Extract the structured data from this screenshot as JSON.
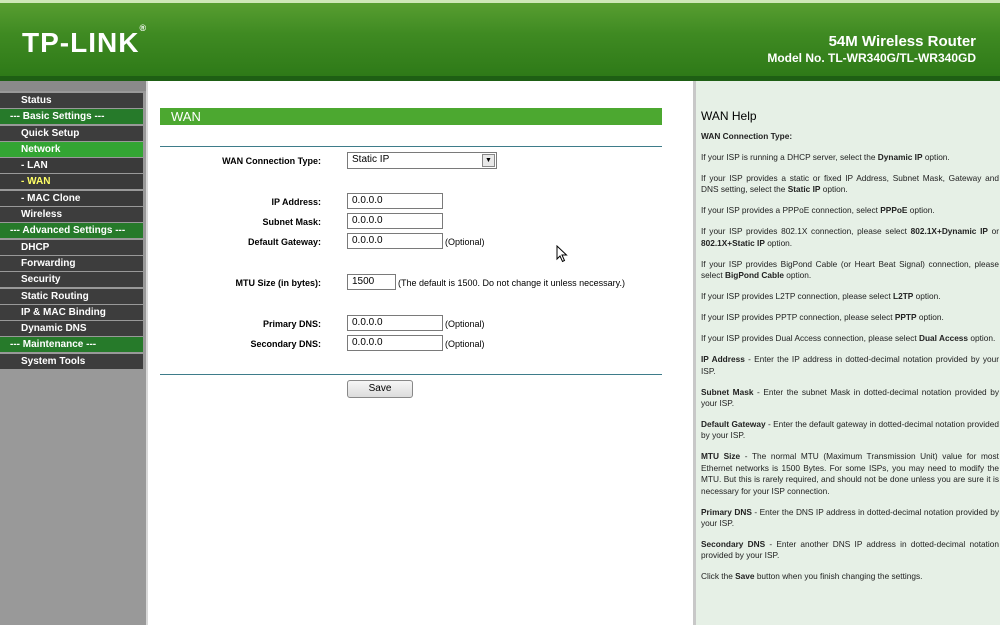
{
  "header": {
    "logo": "TP-LINK",
    "logo_mark": "®",
    "product": "54M Wireless Router",
    "model": "Model No. TL-WR340G/TL-WR340GD"
  },
  "sidebar": {
    "items": [
      {
        "label": "Status",
        "type": "top"
      },
      {
        "label": "--- Basic Settings ---",
        "type": "sec"
      },
      {
        "label": "Quick Setup",
        "type": "top"
      },
      {
        "label": "Network",
        "type": "top active"
      },
      {
        "label": "- LAN",
        "type": "sub"
      },
      {
        "label": "- WAN",
        "type": "sub current"
      },
      {
        "label": "- MAC Clone",
        "type": "sub"
      },
      {
        "label": "Wireless",
        "type": "top"
      },
      {
        "label": "--- Advanced Settings ---",
        "type": "sec"
      },
      {
        "label": "DHCP",
        "type": "top"
      },
      {
        "label": "Forwarding",
        "type": "top"
      },
      {
        "label": "Security",
        "type": "top"
      },
      {
        "label": "Static Routing",
        "type": "top"
      },
      {
        "label": "IP & MAC Binding",
        "type": "top"
      },
      {
        "label": "Dynamic DNS",
        "type": "top"
      },
      {
        "label": "--- Maintenance ---",
        "type": "sec"
      },
      {
        "label": "System Tools",
        "type": "top"
      }
    ]
  },
  "main": {
    "section_title": "WAN",
    "wan_connection_type": {
      "label": "WAN Connection Type:",
      "value": "Static IP"
    },
    "ip_address": {
      "label": "IP Address:",
      "value": "0.0.0.0"
    },
    "subnet_mask": {
      "label": "Subnet Mask:",
      "value": "0.0.0.0"
    },
    "default_gateway": {
      "label": "Default Gateway:",
      "value": "0.0.0.0",
      "note": "(Optional)"
    },
    "mtu_size": {
      "label": "MTU Size (in bytes):",
      "value": "1500",
      "note": "(The default is 1500. Do not change it unless necessary.)"
    },
    "primary_dns": {
      "label": "Primary DNS:",
      "value": "0.0.0.0",
      "note": "(Optional)"
    },
    "secondary_dns": {
      "label": "Secondary DNS:",
      "value": "0.0.0.0",
      "note": "(Optional)"
    },
    "save_label": "Save"
  },
  "help": {
    "title": "WAN Help",
    "paragraphs": [
      {
        "parts": [
          {
            "b": "WAN Connection Type:"
          }
        ]
      },
      {
        "parts": [
          {
            "t": "If your ISP is running a DHCP server, select the "
          },
          {
            "b": "Dynamic IP"
          },
          {
            "t": " option."
          }
        ]
      },
      {
        "parts": [
          {
            "t": "If your ISP provides a static or fixed IP Address, Subnet Mask, Gateway and DNS setting, select the "
          },
          {
            "b": "Static IP"
          },
          {
            "t": " option."
          }
        ]
      },
      {
        "parts": [
          {
            "t": "If your ISP provides a PPPoE connection, select "
          },
          {
            "b": "PPPoE"
          },
          {
            "t": " option."
          }
        ]
      },
      {
        "parts": [
          {
            "t": "If your ISP provides 802.1X connection, please select "
          },
          {
            "b": "802.1X+Dynamic IP"
          },
          {
            "t": " or "
          },
          {
            "b": "802.1X+Static IP"
          },
          {
            "t": " option."
          }
        ]
      },
      {
        "parts": [
          {
            "t": "If your ISP provides BigPond Cable (or Heart Beat Signal) connection, please select "
          },
          {
            "b": "BigPond Cable"
          },
          {
            "t": " option."
          }
        ]
      },
      {
        "parts": [
          {
            "t": "If your ISP provides L2TP connection, please select "
          },
          {
            "b": "L2TP"
          },
          {
            "t": " option."
          }
        ]
      },
      {
        "parts": [
          {
            "t": "If your ISP provides PPTP connection, please select "
          },
          {
            "b": "PPTP"
          },
          {
            "t": " option."
          }
        ]
      },
      {
        "parts": [
          {
            "t": "If your ISP provides Dual Access connection, please select "
          },
          {
            "b": "Dual Access"
          },
          {
            "t": " option."
          }
        ]
      },
      {
        "parts": [
          {
            "b": "IP Address"
          },
          {
            "t": " - Enter the IP address in dotted-decimal notation provided by your ISP."
          }
        ]
      },
      {
        "parts": [
          {
            "b": "Subnet Mask"
          },
          {
            "t": " - Enter the subnet Mask in dotted-decimal notation provided by your ISP."
          }
        ]
      },
      {
        "parts": [
          {
            "b": "Default Gateway"
          },
          {
            "t": " - Enter the default gateway in dotted-decimal notation provided by your ISP."
          }
        ]
      },
      {
        "parts": [
          {
            "b": "MTU Size"
          },
          {
            "t": " - The normal MTU (Maximum Transmission Unit) value for most Ethernet networks is 1500 Bytes. For some ISPs, you may need to modify the MTU. But this is rarely required, and should not be done unless you are sure it is necessary for your ISP connection."
          }
        ]
      },
      {
        "parts": [
          {
            "b": "Primary DNS"
          },
          {
            "t": " - Enter the DNS IP address in dotted-decimal notation provided by your ISP."
          }
        ]
      },
      {
        "parts": [
          {
            "b": "Secondary DNS"
          },
          {
            "t": " - Enter another DNS IP address in dotted-decimal notation provided by your ISP."
          }
        ]
      },
      {
        "parts": [
          {
            "t": "Click the "
          },
          {
            "b": "Save"
          },
          {
            "t": " button when you finish changing the settings."
          }
        ]
      }
    ]
  }
}
